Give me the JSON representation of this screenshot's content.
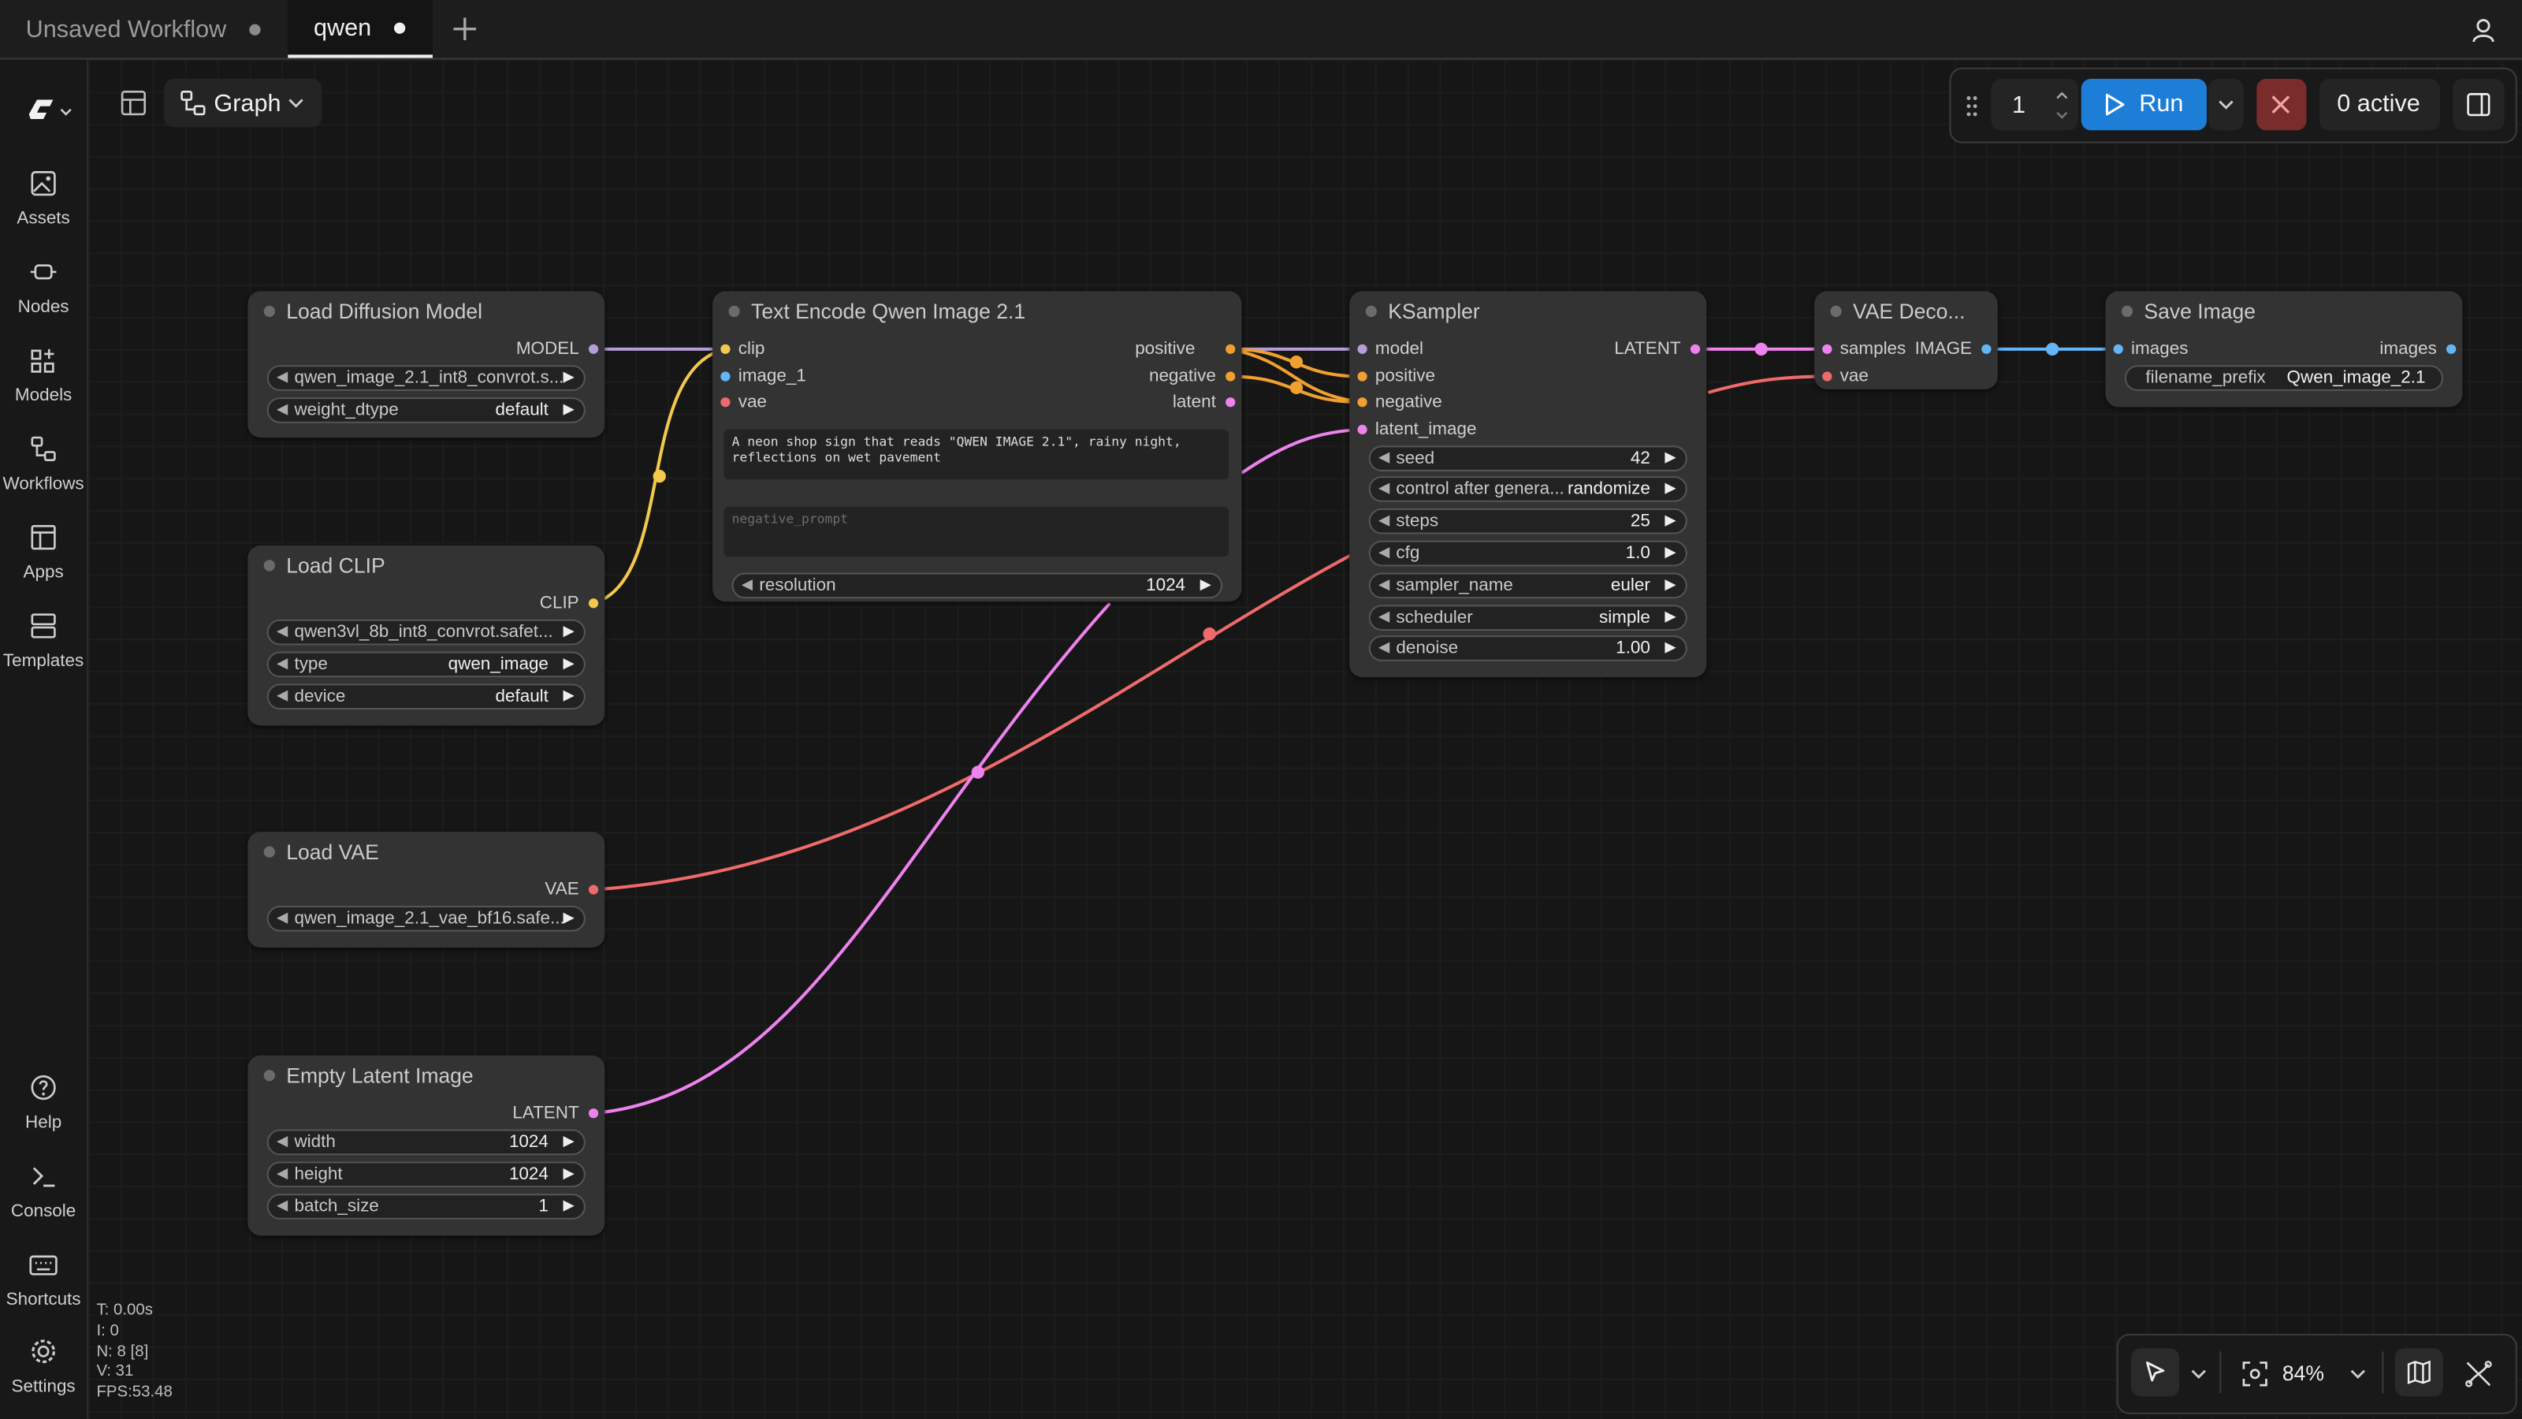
{
  "tabs": [
    {
      "label": "Unsaved Workflow",
      "modified": true,
      "active": false
    },
    {
      "label": "qwen",
      "modified": true,
      "active": true
    }
  ],
  "header": {
    "view_label": "Graph"
  },
  "sidebar": {
    "items": [
      {
        "label": "Assets",
        "icon": "image-icon"
      },
      {
        "label": "Nodes",
        "icon": "node-icon"
      },
      {
        "label": "Models",
        "icon": "models-icon"
      },
      {
        "label": "Workflows",
        "icon": "workflow-icon"
      },
      {
        "label": "Apps",
        "icon": "apps-icon"
      },
      {
        "label": "Templates",
        "icon": "templates-icon"
      }
    ],
    "bottom_items": [
      {
        "label": "Help",
        "icon": "help-icon"
      },
      {
        "label": "Console",
        "icon": "terminal-icon"
      },
      {
        "label": "Shortcuts",
        "icon": "keyboard-icon"
      },
      {
        "label": "Settings",
        "icon": "gear-icon"
      }
    ]
  },
  "runbar": {
    "batch_count": "1",
    "run_label": "Run",
    "active_label": "0 active"
  },
  "zoom": {
    "level": "84%"
  },
  "stats": {
    "t": "T: 0.00s",
    "i": "I: 0",
    "n": "N: 8 [8]",
    "v": "V: 31",
    "fps": "FPS:53.48"
  },
  "nodes": {
    "load_diffusion": {
      "title": "Load Diffusion Model",
      "output": "MODEL",
      "widgets": [
        {
          "label": "",
          "value": "qwen_image_2.1_int8_convrot.s..."
        },
        {
          "label": "weight_dtype",
          "value": "default"
        }
      ]
    },
    "load_clip": {
      "title": "Load CLIP",
      "output": "CLIP",
      "widgets": [
        {
          "label": "",
          "value": "qwen3vl_8b_int8_convrot.safet..."
        },
        {
          "label": "type",
          "value": "qwen_image"
        },
        {
          "label": "device",
          "value": "default"
        }
      ]
    },
    "load_vae": {
      "title": "Load VAE",
      "output": "VAE",
      "widgets": [
        {
          "label": "",
          "value": "qwen_image_2.1_vae_bf16.safe..."
        }
      ]
    },
    "empty_latent": {
      "title": "Empty Latent Image",
      "output": "LATENT",
      "widgets": [
        {
          "label": "width",
          "value": "1024"
        },
        {
          "label": "height",
          "value": "1024"
        },
        {
          "label": "batch_size",
          "value": "1"
        }
      ]
    },
    "text_encode": {
      "title": "Text Encode Qwen Image 2.1",
      "inputs": [
        "clip",
        "image_1",
        "vae"
      ],
      "outputs": [
        "positive",
        "negative",
        "latent"
      ],
      "prompt": "A neon shop sign that reads \"QWEN IMAGE 2.1\", rainy night, reflections on wet pavement",
      "negative_placeholder": "negative_prompt",
      "widgets": [
        {
          "label": "resolution",
          "value": "1024"
        }
      ]
    },
    "ksampler": {
      "title": "KSampler",
      "inputs": [
        "model",
        "positive",
        "negative",
        "latent_image"
      ],
      "output": "LATENT",
      "widgets": [
        {
          "label": "seed",
          "value": "42"
        },
        {
          "label": "control after genera...",
          "value": "randomize"
        },
        {
          "label": "steps",
          "value": "25"
        },
        {
          "label": "cfg",
          "value": "1.0"
        },
        {
          "label": "sampler_name",
          "value": "euler"
        },
        {
          "label": "scheduler",
          "value": "simple"
        },
        {
          "label": "denoise",
          "value": "1.00"
        }
      ]
    },
    "vae_decode": {
      "title": "VAE Deco...",
      "inputs": [
        "samples",
        "vae"
      ],
      "output": "IMAGE"
    },
    "save_image": {
      "title": "Save Image",
      "input": "images",
      "output": "images",
      "widgets": [
        {
          "label": "filename_prefix",
          "value": "Qwen_image_2.1"
        }
      ]
    }
  },
  "colors": {
    "model": "#b39ddb",
    "clip": "#f2c94c",
    "vae": "#ef6a6a",
    "latent": "#ee82ee",
    "conditioning": "#f0a030",
    "image": "#64b5f6",
    "run": "#1c7ed6",
    "cancel": "#7a2b2b"
  }
}
